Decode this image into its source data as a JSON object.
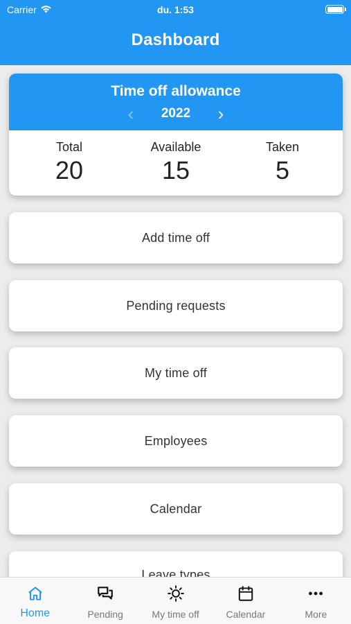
{
  "status_bar": {
    "carrier": "Carrier",
    "time": "du. 1:53"
  },
  "header": {
    "title": "Dashboard"
  },
  "allowance": {
    "title": "Time off allowance",
    "year": "2022",
    "stats": [
      {
        "label": "Total",
        "value": "20"
      },
      {
        "label": "Available",
        "value": "15"
      },
      {
        "label": "Taken",
        "value": "5"
      }
    ]
  },
  "menu": [
    {
      "label": "Add time off"
    },
    {
      "label": "Pending requests"
    },
    {
      "label": "My time off"
    },
    {
      "label": "Employees"
    },
    {
      "label": "Calendar"
    },
    {
      "label": "Leave types"
    }
  ],
  "tabs": [
    {
      "label": "Home",
      "icon": "home-icon",
      "active": true
    },
    {
      "label": "Pending",
      "icon": "chat-bubbles-icon",
      "active": false
    },
    {
      "label": "My time off",
      "icon": "sun-icon",
      "active": false
    },
    {
      "label": "Calendar",
      "icon": "calendar-icon",
      "active": false
    },
    {
      "label": "More",
      "icon": "more-dots-icon",
      "active": false
    }
  ],
  "colors": {
    "primary": "#2196f3",
    "background": "#ececec",
    "tab_inactive": "#777777"
  }
}
